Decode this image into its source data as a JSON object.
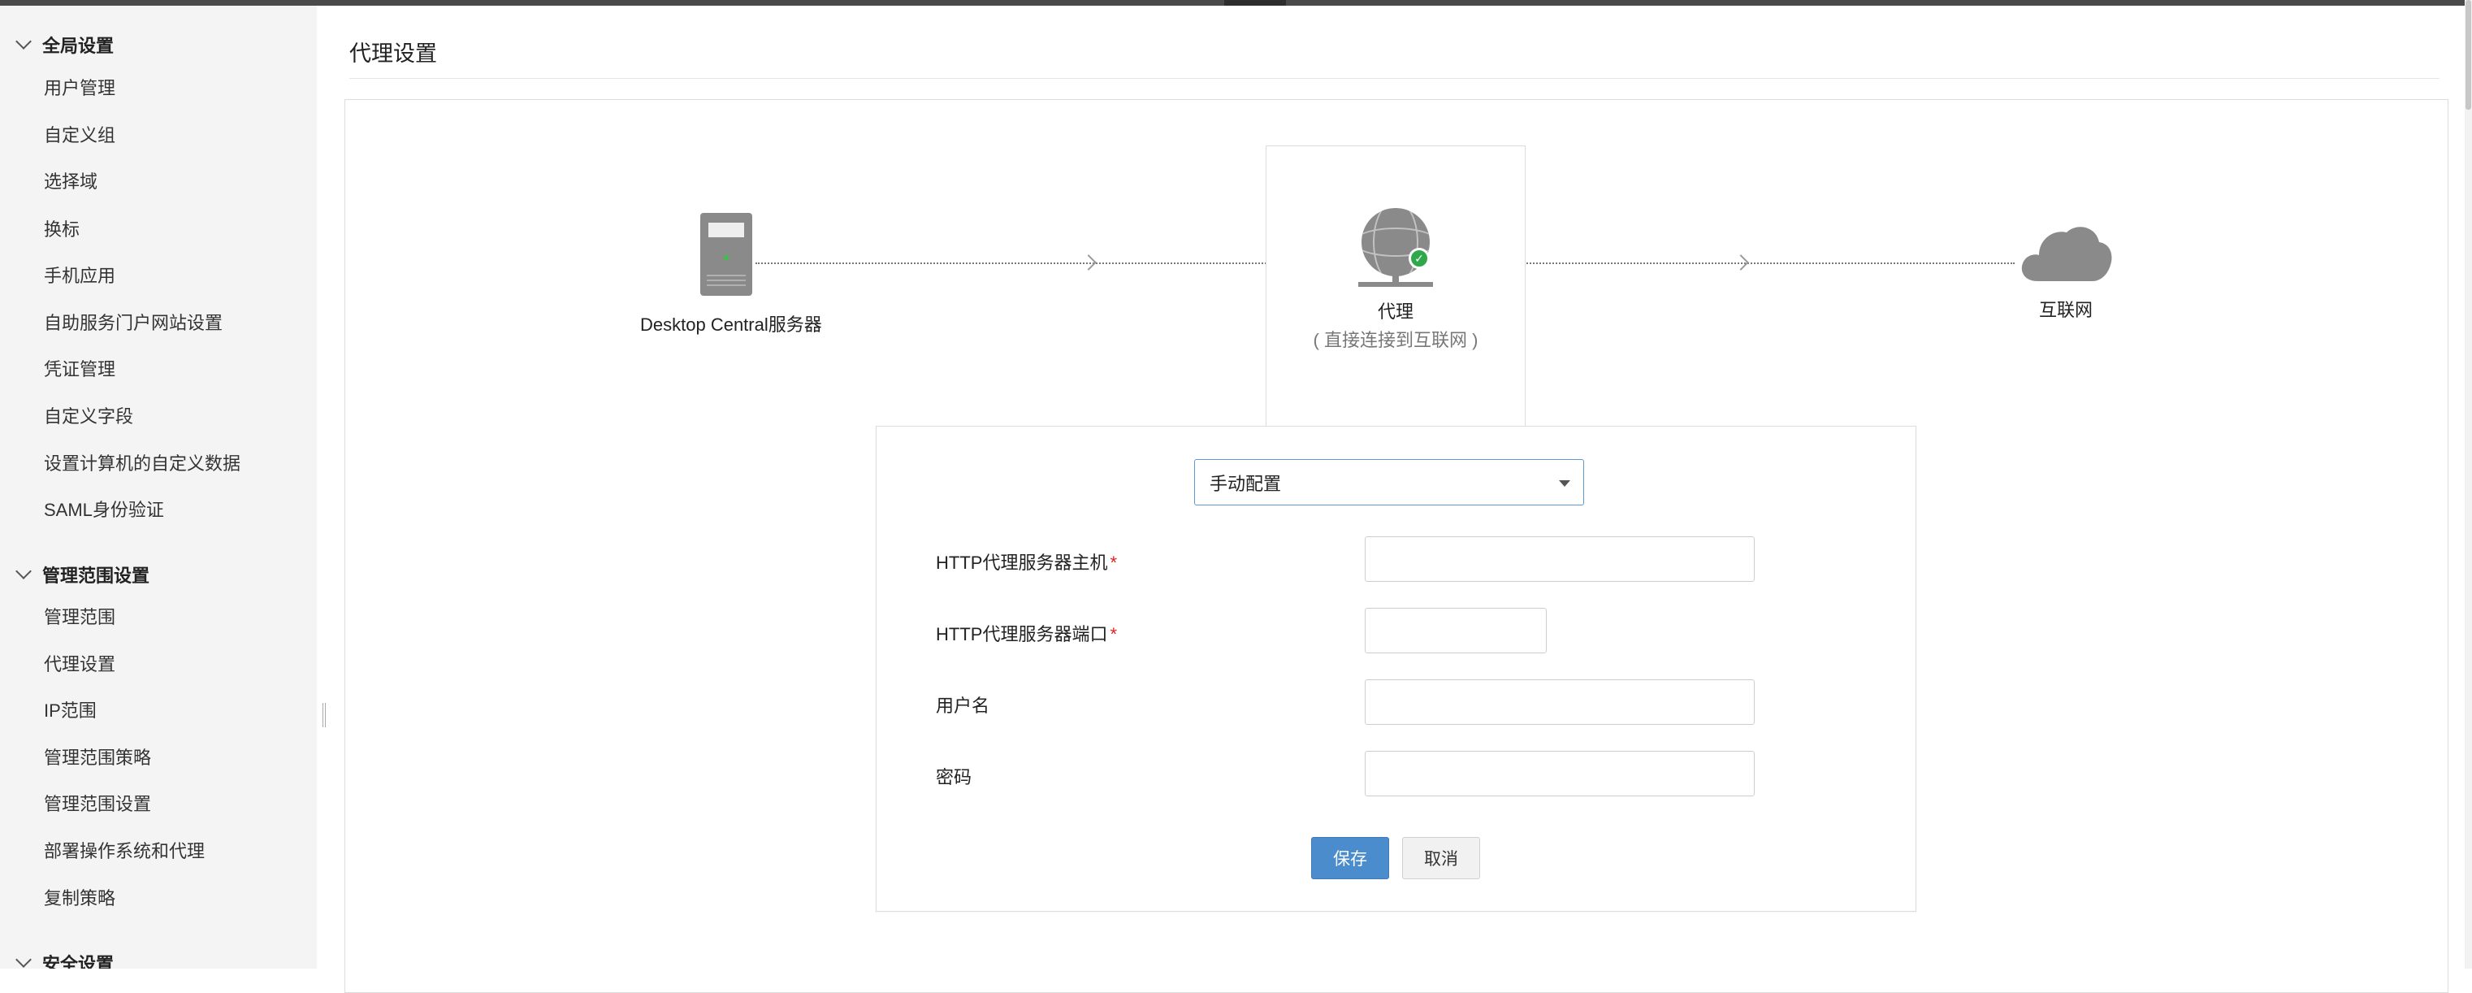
{
  "sidebar": {
    "sections": [
      {
        "title": "全局设置",
        "items": [
          "用户管理",
          "自定义组",
          "选择域",
          "换标",
          "手机应用",
          "自助服务门户网站设置",
          "凭证管理",
          "自定义字段",
          "设置计算机的自定义数据",
          "SAML身份验证"
        ]
      },
      {
        "title": "管理范围设置",
        "items": [
          "管理范围",
          "代理设置",
          "IP范围",
          "管理范围策略",
          "管理范围设置",
          "部署操作系统和代理",
          "复制策略"
        ]
      },
      {
        "title": "安全设置",
        "items": []
      }
    ]
  },
  "page": {
    "title": "代理设置"
  },
  "diagram": {
    "server_label": "Desktop Central服务器",
    "proxy_label": "代理",
    "proxy_sublabel": "( 直接连接到互联网 )",
    "internet_label": "互联网"
  },
  "form": {
    "mode_select_value": "手动配置",
    "host_label": "HTTP代理服务器主机",
    "port_label": "HTTP代理服务器端口",
    "username_label": "用户名",
    "password_label": "密码",
    "required_mark": "*",
    "save_label": "保存",
    "cancel_label": "取消"
  },
  "colors": {
    "primary_button": "#4a8ccc",
    "required": "#e02020",
    "status_ok": "#2ea84a"
  }
}
